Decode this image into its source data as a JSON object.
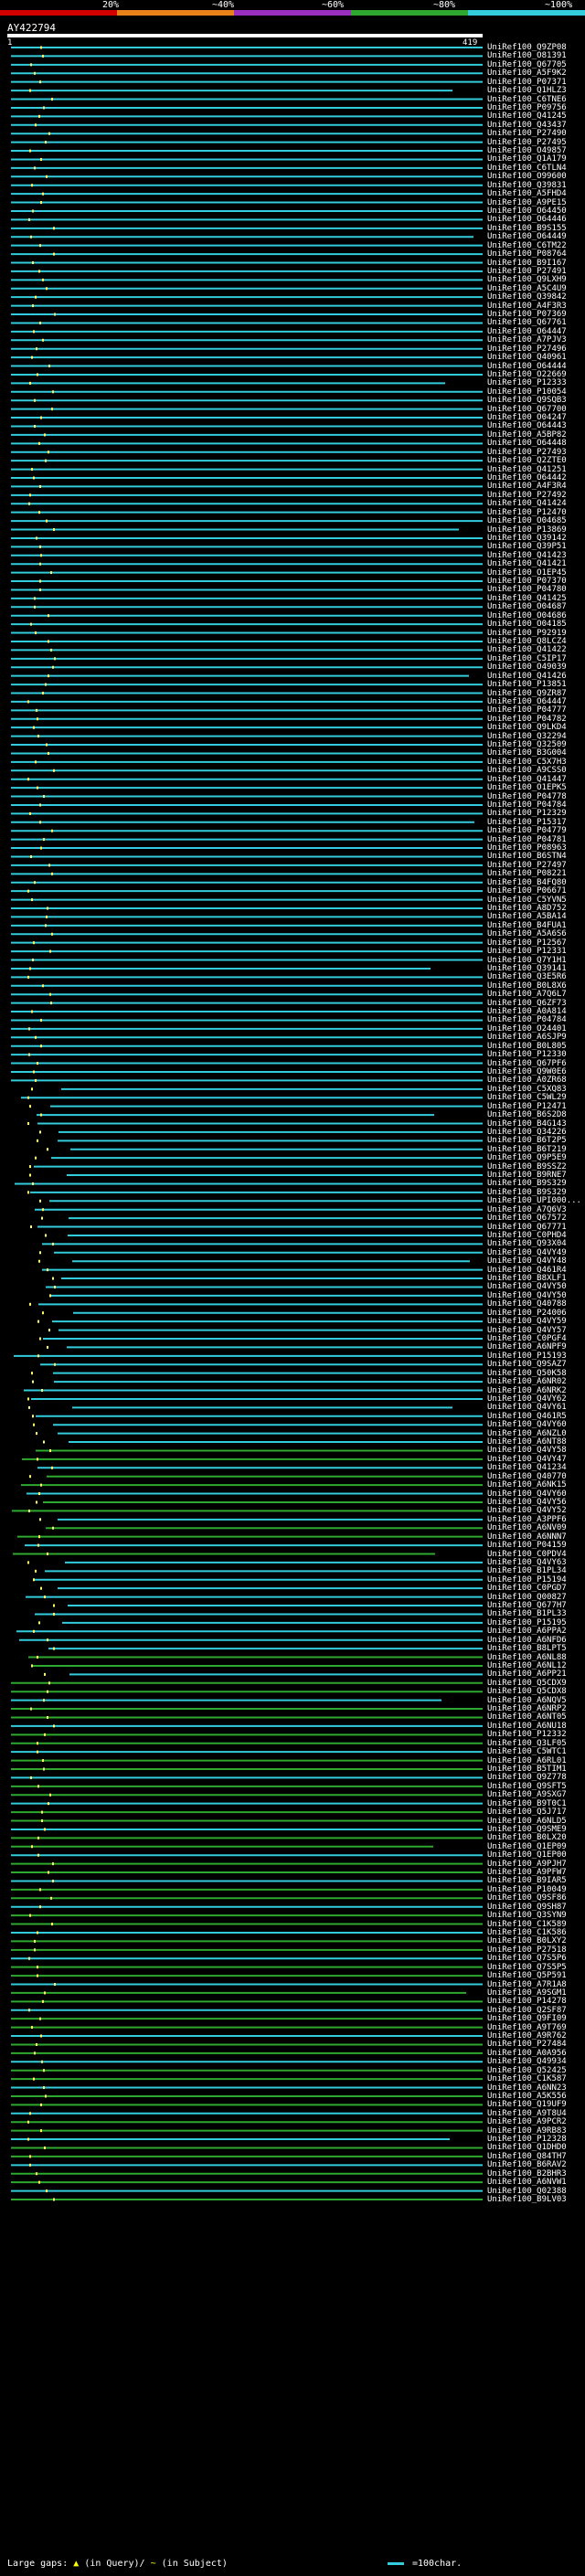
{
  "scale": {
    "ticks": [
      "20%",
      "~40%",
      "~60%",
      "~80%",
      "~100%"
    ],
    "colors": [
      "#d40000",
      "#e8811a",
      "#9a2fbf",
      "#2ea82e",
      "#33ccdd"
    ]
  },
  "query": {
    "id": "AY422794",
    "start": "1",
    "end": "419"
  },
  "legend": {
    "large_gaps": "Large gaps:",
    "in_query": "(in Query)/",
    "in_subject": "(in Subject)",
    "scale_note": "=100char."
  },
  "hits": [
    "UniRef100_Q9ZP08",
    "UniRef100_O81391",
    "UniRef100_Q67705",
    "UniRef100_A5F9K2",
    "UniRef100_P07371",
    "UniRef100_Q1HLZ3",
    "UniRef100_C6TNE6",
    "UniRef100_P09756",
    "UniRef100_Q41245",
    "UniRef100_Q43437",
    "UniRef100_P27490",
    "UniRef100_P27495",
    "UniRef100_O49857",
    "UniRef100_Q1A179",
    "UniRef100_C6TLN4",
    "UniRef100_O99600",
    "UniRef100_Q39831",
    "UniRef100_A5FHD4",
    "UniRef100_A9PE15",
    "UniRef100_O64450",
    "UniRef100_O64446",
    "UniRef100_B9S155",
    "UniRef100_O64449",
    "UniRef100_C6TM22",
    "UniRef100_P08764",
    "UniRef100_B9I167",
    "UniRef100_P27491",
    "UniRef100_Q9LXH9",
    "UniRef100_A5C4U9",
    "UniRef100_Q39842",
    "UniRef100_A4F3R3",
    "UniRef100_P07369",
    "UniRef100_Q67761",
    "UniRef100_O64447",
    "UniRef100_A7PJV3",
    "UniRef100_P27496",
    "UniRef100_Q40961",
    "UniRef100_O64444",
    "UniRef100_O22669",
    "UniRef100_P12333",
    "UniRef100_P10054",
    "UniRef100_Q9SQB3",
    "UniRef100_Q67700",
    "UniRef100_O04247",
    "UniRef100_O64443",
    "UniRef100_A5BP82",
    "UniRef100_O64448",
    "UniRef100_P27493",
    "UniRef100_Q2ZTE0",
    "UniRef100_Q41251",
    "UniRef100_O64442",
    "UniRef100_A4F3R4",
    "UniRef100_P27492",
    "UniRef100_Q41424",
    "UniRef100_P12470",
    "UniRef100_O04685",
    "UniRef100_P13869",
    "UniRef100_Q39142",
    "UniRef100_Q39P51",
    "UniRef100_Q41423",
    "UniRef100_Q41421",
    "UniRef100_O1EP45",
    "UniRef100_P07370",
    "UniRef100_P04780",
    "UniRef100_Q41425",
    "UniRef100_O04687",
    "UniRef100_O04686",
    "UniRef100_O04185",
    "UniRef100_P92919",
    "UniRef100_Q8LCZ4",
    "UniRef100_Q41422",
    "UniRef100_C5IP17",
    "UniRef100_O49039",
    "UniRef100_Q41426",
    "UniRef100_P13851",
    "UniRef100_Q9ZR87",
    "UniRef100_O64447",
    "UniRef100_P04777",
    "UniRef100_P04782",
    "UniRef100_Q9LKD4",
    "UniRef100_Q32294",
    "UniRef100_Q32509",
    "UniRef100_B3G004",
    "UniRef100_C5X7H3",
    "UniRef100_A9CSS0",
    "UniRef100_Q41447",
    "UniRef100_O1EPK5",
    "UniRef100_P04778",
    "UniRef100_P04784",
    "UniRef100_P12329",
    "UniRef100_P15317",
    "UniRef100_P04779",
    "UniRef100_P04781",
    "UniRef100_P08963",
    "UniRef100_B6STN4",
    "UniRef100_P27497",
    "UniRef100_P08221",
    "UniRef100_B4FQ80",
    "UniRef100_P06671",
    "UniRef100_C5YVN5",
    "UniRef100_A8D752",
    "UniRef100_A5BA14",
    "UniRef100_B4FUA1",
    "UniRef100_A5A6S6",
    "UniRef100_P12567",
    "UniRef100_P12331",
    "UniRef100_Q7Y1H1",
    "UniRef100_Q39141",
    "UniRef100_Q3E5R6",
    "UniRef100_B0L8X6",
    "UniRef100_A7Q6L7",
    "UniRef100_Q6ZF73",
    "UniRef100_A0A814",
    "UniRef100_P04784",
    "UniRef100_O24401",
    "UniRef100_A6SJP9",
    "UniRef100_B0L805",
    "UniRef100_P12330",
    "UniRef100_Q67PF6",
    "UniRef100_Q9W0E6",
    "UniRef100_A0ZR68",
    "UniRef100_C5XQ83",
    "UniRef100_C5WL29",
    "UniRef100_P12471",
    "UniRef100_B6S2D8",
    "UniRef100_B4G143",
    "UniRef100_Q34226",
    "UniRef100_B6T2P5",
    "UniRef100_B6T219",
    "UniRef100_Q9P5E9",
    "UniRef100_B9SSZ2",
    "UniRef100_B9RNE7",
    "UniRef100_B9S329",
    "UniRef100_B9S329",
    "UniRef100_UPI000...",
    "UniRef100_A7Q6V3",
    "UniRef100_Q67572",
    "UniRef100_Q67771",
    "UniRef100_C0PHD4",
    "UniRef100_Q93X04",
    "UniRef100_Q4VY49",
    "UniRef100_Q4VY48",
    "UniRef100_Q461R4",
    "UniRef100_B8XLF1",
    "UniRef100_Q4VY50",
    "UniRef100_Q4VY50",
    "UniRef100_Q40788",
    "UniRef100_P24006",
    "UniRef100_Q4VY59",
    "UniRef100_Q4VY57",
    "UniRef100_C0PGF4",
    "UniRef100_A6NPF9",
    "UniRef100_P15193",
    "UniRef100_Q9SAZ7",
    "UniRef100_Q50K58",
    "UniRef100_A6NR02",
    "UniRef100_A6NRK2",
    "UniRef100_Q4VY62",
    "UniRef100_Q4VY61",
    "UniRef100_Q461R5",
    "UniRef100_Q4VY60",
    "UniRef100_A6NZL0",
    "UniRef100_A6NT88",
    "UniRef100_Q4VY58",
    "UniRef100_Q4VY47",
    "UniRef100_Q41234",
    "UniRef100_Q40770",
    "UniRef100_A6NK15",
    "UniRef100_Q4VY60",
    "UniRef100_Q4VY56",
    "UniRef100_Q4VY52",
    "UniRef100_A3PPF6",
    "UniRef100_A6NV09",
    "UniRef100_A6NNN7",
    "UniRef100_P04159",
    "UniRef100_C0PDV4",
    "UniRef100_Q4VY63",
    "UniRef100_B1PL34",
    "UniRef100_P15194",
    "UniRef100_C0PGD7",
    "UniRef100_Q00827",
    "UniRef100_Q677H7",
    "UniRef100_B1PL33",
    "UniRef100_P15195",
    "UniRef100_A6PPA2",
    "UniRef100_A6NFD6",
    "UniRef100_B8LPT5",
    "UniRef100_A6NL88",
    "UniRef100_A6NL12",
    "UniRef100_A6PP21",
    "UniRef100_Q5CDX9",
    "UniRef100_Q5CDX8",
    "UniRef100_A6NQV5",
    "UniRef100_A6NRP2",
    "UniRef100_A6NT05",
    "UniRef100_A6NU18",
    "UniRef100_P12332",
    "UniRef100_Q3LF05",
    "UniRef100_C5WTC1",
    "UniRef100_A6RL01",
    "UniRef100_B5TIM1",
    "UniRef100_Q9Z778",
    "UniRef100_Q9SFT5",
    "UniRef100_A9SXG7",
    "UniRef100_B9T0C1",
    "UniRef100_Q5J717",
    "UniRef100_A6NLD5",
    "UniRef100_Q9SME9",
    "UniRef100_B0LX20",
    "UniRef100_Q1EP09",
    "UniRef100_Q1EP00",
    "UniRef100_A9PJH7",
    "UniRef100_A9PFW7",
    "UniRef100_B9IAR5",
    "UniRef100_P10049",
    "UniRef100_Q9SF86",
    "UniRef100_Q9SH87",
    "UniRef100_Q3SYN9",
    "UniRef100_C1K589",
    "UniRef100_C1K586",
    "UniRef100_B0LXY2",
    "UniRef100_P27518",
    "UniRef100_Q7S5P6",
    "UniRef100_Q7S5P5",
    "UniRef100_Q5P591",
    "UniRef100_A7R1A8",
    "UniRef100_A9SGM1",
    "UniRef100_P14278",
    "UniRef100_Q2SF87",
    "UniRef100_Q9FI09",
    "UniRef100_A9T769",
    "UniRef100_A9R762",
    "UniRef100_P27484",
    "UniRef100_A0A956",
    "UniRef100_Q49934",
    "UniRef100_Q52425",
    "UniRef100_C1K587",
    "UniRef100_A6NN23",
    "UniRef100_A5K556",
    "UniRef100_Q19UF9",
    "UniRef100_A9T8U4",
    "UniRef100_A9PCR2",
    "UniRef100_A9RB83",
    "UniRef100_P12328",
    "UniRef100_Q1DHD0",
    "UniRef100_Q84TH7",
    "UniRef100_B6RAV2",
    "UniRef100_B2BHR3",
    "UniRef100_A6NVW1",
    "UniRef100_Q02388",
    "UniRef100_B9LV03"
  ]
}
